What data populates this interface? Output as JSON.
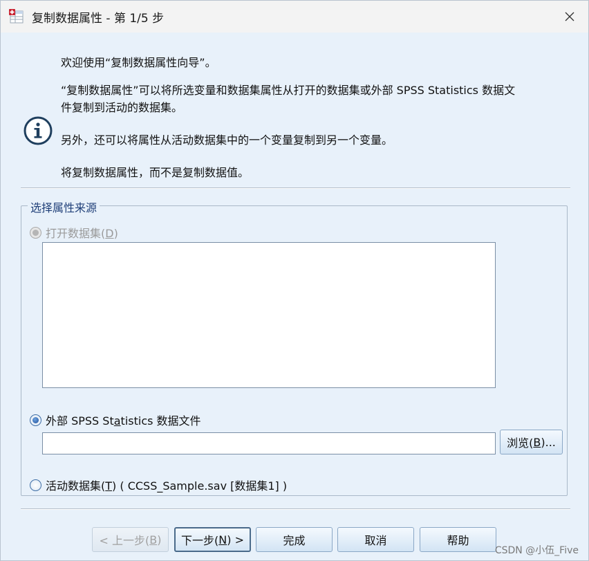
{
  "window": {
    "title": "复制数据属性 - 第 1/5 步",
    "close_glyph": "✕",
    "app_icon": "spss-data-icon"
  },
  "intro": {
    "info_icon": "info-icon",
    "welcome": "欢迎使用“复制数据属性向导”。",
    "desc_line1": "“复制数据属性”可以将所选变量和数据集属性从打开的数据集或外部 SPSS Statistics 数据文",
    "desc_line2": "件复制到活动的数据集。",
    "also": "另外，还可以将属性从活动数据集中的一个变量复制到另一个变量。",
    "note": "将复制数据属性，而不是复制数据值。"
  },
  "source_group": {
    "legend": "选择属性来源",
    "open_dataset": {
      "label": "打开数据集(",
      "mnemonic": "D",
      "suffix": ")",
      "selected": false,
      "enabled": false
    },
    "dataset_list": [],
    "external_file": {
      "prefix": "外部 SPSS St",
      "mnemonic": "a",
      "suffix": "tistics 数据文件",
      "selected": true,
      "enabled": true
    },
    "file_path": "",
    "browse": {
      "label": "浏览(",
      "mnemonic": "B",
      "suffix": ")..."
    },
    "active_dataset": {
      "label": "活动数据集(",
      "mnemonic": "T",
      "suffix": ") ( CCSS_Sample.sav [数据集1] )",
      "selected": false,
      "enabled": true
    }
  },
  "footer": {
    "back": {
      "label": "< 上一步(",
      "mnemonic": "B",
      "suffix": ")",
      "enabled": false
    },
    "next": {
      "label": "下一步(",
      "mnemonic": "N",
      "suffix": ") >",
      "default": true
    },
    "finish": "完成",
    "cancel": "取消",
    "help": "帮助"
  },
  "watermark": "CSDN @小伍_Five",
  "colors": {
    "dialog_bg": "#e8f1fa",
    "legend_text": "#1f3f78",
    "radio_accent": "#1e4f9a"
  }
}
